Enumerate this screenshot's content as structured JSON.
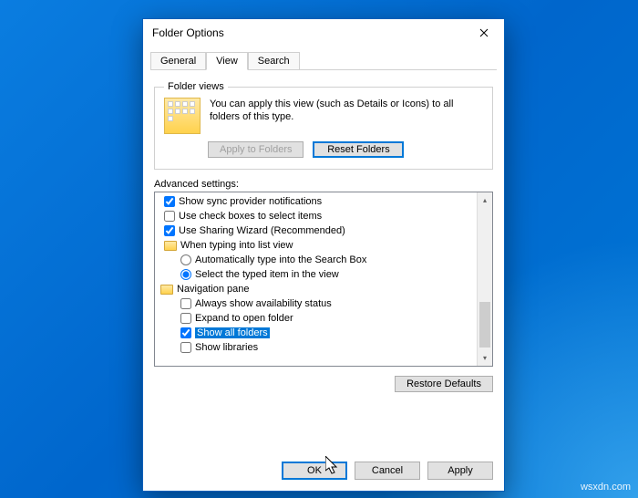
{
  "window": {
    "title": "Folder Options"
  },
  "tabs": {
    "general": "General",
    "view": "View",
    "search": "Search"
  },
  "folderViews": {
    "legend": "Folder views",
    "desc": "You can apply this view (such as Details or Icons) to all folders of this type.",
    "applyBtn": "Apply to Folders",
    "resetBtn": "Reset Folders"
  },
  "advanced": {
    "label": "Advanced settings:",
    "items": {
      "sync": "Show sync provider notifications",
      "checkboxes": "Use check boxes to select items",
      "sharing": "Use Sharing Wizard (Recommended)",
      "typingGroup": "When typing into list view",
      "typingAuto": "Automatically type into the Search Box",
      "typingSelect": "Select the typed item in the view",
      "navGroup": "Navigation pane",
      "navAvail": "Always show availability status",
      "navExpand": "Expand to open folder",
      "navShowAll": "Show all folders",
      "navLibs": "Show libraries"
    }
  },
  "restoreBtn": "Restore Defaults",
  "buttons": {
    "ok": "OK",
    "cancel": "Cancel",
    "apply": "Apply"
  },
  "watermark": "wsxdn.com"
}
